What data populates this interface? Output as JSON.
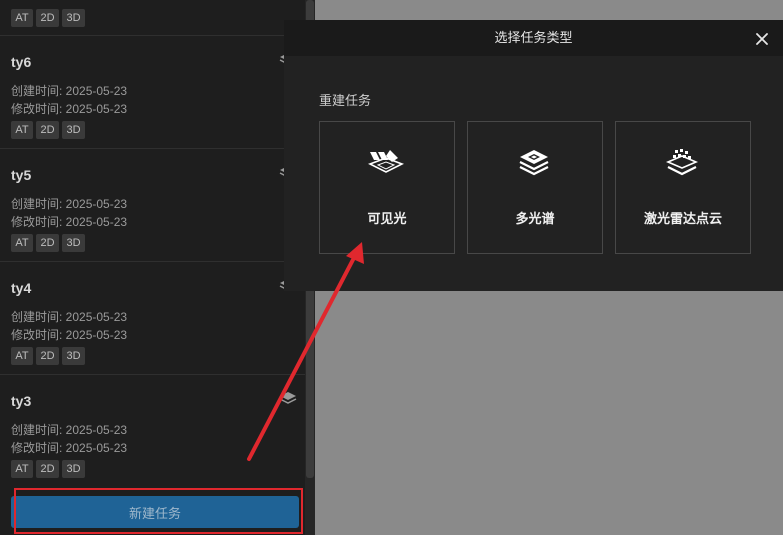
{
  "sidebar": {
    "top_partial_task": {
      "tags": [
        "AT",
        "2D",
        "3D"
      ]
    },
    "tasks": [
      {
        "name": "ty6",
        "created": "创建时间: 2025-05-23",
        "modified": "修改时间: 2025-05-23",
        "tags": [
          "AT",
          "2D",
          "3D"
        ]
      },
      {
        "name": "ty5",
        "created": "创建时间: 2025-05-23",
        "modified": "修改时间: 2025-05-23",
        "tags": [
          "AT",
          "2D",
          "3D"
        ]
      },
      {
        "name": "ty4",
        "created": "创建时间: 2025-05-23",
        "modified": "修改时间: 2025-05-23",
        "tags": [
          "AT",
          "2D",
          "3D"
        ]
      },
      {
        "name": "ty3",
        "created": "创建时间: 2025-05-23",
        "modified": "修改时间: 2025-05-23",
        "tags": [
          "AT",
          "2D",
          "3D"
        ]
      }
    ],
    "new_task_label": "新建任务"
  },
  "modal": {
    "title": "选择任务类型",
    "section_label": "重建任务",
    "options": [
      {
        "label": "可见光",
        "icon": "visible-light-icon"
      },
      {
        "label": "多光谱",
        "icon": "multispectral-icon"
      },
      {
        "label": "激光雷达点云",
        "icon": "lidar-pointcloud-icon"
      }
    ]
  },
  "colors": {
    "accent_button": "#1f6396",
    "annotation_red": "#e0282e",
    "panel_bg": "#1e1e1e",
    "modal_bg": "#222222"
  }
}
